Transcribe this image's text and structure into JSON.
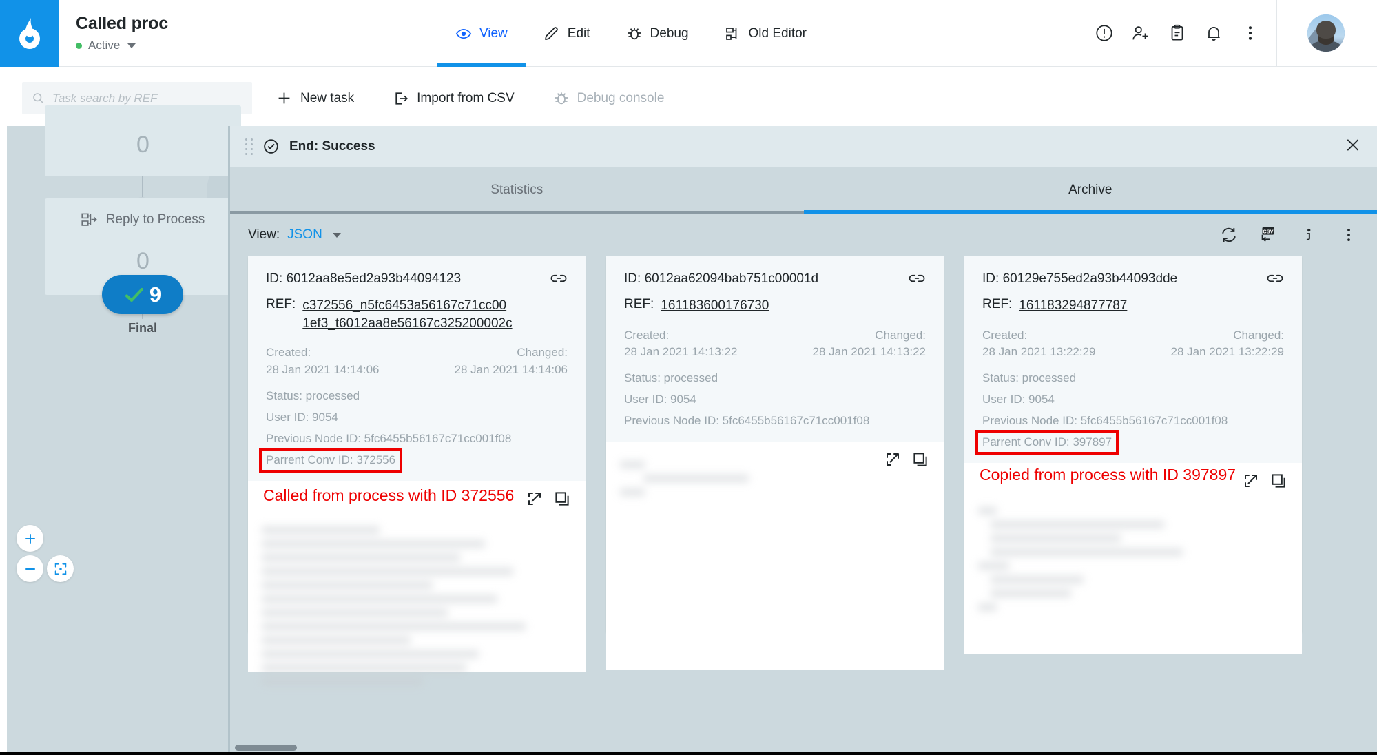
{
  "header": {
    "logo_icon": "infinity-drop-logo",
    "title": "Called proc",
    "status": "Active",
    "status_color": "#42be65",
    "tabs": [
      {
        "label": "View",
        "icon": "eye-icon",
        "active": true
      },
      {
        "label": "Edit",
        "icon": "pencil-icon",
        "active": false
      },
      {
        "label": "Debug",
        "icon": "bug-icon",
        "active": false
      },
      {
        "label": "Old Editor",
        "icon": "sitemap-icon",
        "active": false
      }
    ],
    "actions": [
      {
        "name": "alert-circle-icon"
      },
      {
        "name": "add-user-icon"
      },
      {
        "name": "clipboard-icon"
      },
      {
        "name": "bell-icon"
      },
      {
        "name": "overflow-menu-icon"
      }
    ],
    "accent_color": "#1192e8"
  },
  "toolbar": {
    "search_placeholder": "Task search by REF",
    "search_value": "",
    "new_task": "New task",
    "import_csv": "Import from CSV",
    "debug_console": "Debug console"
  },
  "canvas": {
    "nodes": [
      {
        "label": "",
        "count": "0"
      },
      {
        "label": "Reply to Process",
        "count": "0",
        "icon": "reply-to-process-icon"
      }
    ],
    "final": {
      "count": "9",
      "label": "Final",
      "icon": "check-icon"
    },
    "zoom_controls": [
      {
        "name": "zoom-in-button",
        "glyph": "+"
      },
      {
        "name": "zoom-out-button",
        "glyph": "−"
      },
      {
        "name": "fit-to-screen-button",
        "glyph": "focus"
      }
    ]
  },
  "panel": {
    "title": "End: Success",
    "title_icon": "check-circle-icon",
    "close_icon": "close-icon",
    "drag_handle": "drag-handle-icon",
    "tabs": [
      {
        "label": "Statistics",
        "active": false
      },
      {
        "label": "Archive",
        "active": true
      }
    ],
    "view_label": "View:",
    "view_value": "JSON",
    "view_options": [
      "JSON"
    ],
    "view_icons": [
      {
        "name": "refresh-icon"
      },
      {
        "name": "export-csv-icon",
        "text": "CSV"
      },
      {
        "name": "info-icon"
      },
      {
        "name": "overflow-menu-icon"
      }
    ]
  },
  "cards": [
    {
      "id_label": "ID:",
      "id_value": "6012aa8e5ed2a93b44094123",
      "ref_label": "REF:",
      "ref_value": "c372556_n5fc6453a56167c71cc001ef3_t6012aa8e56167c325200002c",
      "created_label": "Created:",
      "created_value": "28 Jan 2021 14:14:06",
      "changed_label": "Changed:",
      "changed_value": "28 Jan 2021 14:14:06",
      "status": "Status: processed",
      "user_id": "User ID: 9054",
      "previous_node_id": "Previous Node ID: 5fc6455b56167c71cc001f08",
      "parent_conv_id": "Parrent Conv ID: 372556",
      "parent_highlighted": true,
      "annotation": "Called from process with ID 372556",
      "link_icon": "link-icon",
      "expand_icon": "expand-icon",
      "copy_icon": "copy-icon"
    },
    {
      "id_label": "ID:",
      "id_value": "6012aa62094bab751c00001d",
      "ref_label": "REF:",
      "ref_value": "161183600176730",
      "created_label": "Created:",
      "created_value": "28 Jan 2021 14:13:22",
      "changed_label": "Changed:",
      "changed_value": "28 Jan 2021 14:13:22",
      "status": "Status: processed",
      "user_id": "User ID: 9054",
      "previous_node_id": "Previous Node ID: 5fc6455b56167c71cc001f08",
      "parent_conv_id": "",
      "parent_highlighted": false,
      "annotation": "",
      "link_icon": "link-icon",
      "expand_icon": "expand-icon",
      "copy_icon": "copy-icon"
    },
    {
      "id_label": "ID:",
      "id_value": "60129e755ed2a93b44093dde",
      "ref_label": "REF:",
      "ref_value": "161183294877787",
      "created_label": "Created:",
      "created_value": "28 Jan 2021 13:22:29",
      "changed_label": "Changed:",
      "changed_value": "28 Jan 2021 13:22:29",
      "status": "Status: processed",
      "user_id": "User ID: 9054",
      "previous_node_id": "Previous Node ID: 5fc6455b56167c71cc001f08",
      "parent_conv_id": "Parrent Conv ID: 397897",
      "parent_highlighted": true,
      "annotation": "Copied from process with ID 397897",
      "link_icon": "link-icon",
      "expand_icon": "expand-icon",
      "copy_icon": "copy-icon"
    }
  ],
  "colors": {
    "brand_blue": "#1192e8",
    "link_blue": "#0f62fe",
    "annotation_red": "#ee0000",
    "status_green": "#42be65",
    "panel_bg": "#ccd9de",
    "card_head_bg": "#f4f8fa"
  }
}
